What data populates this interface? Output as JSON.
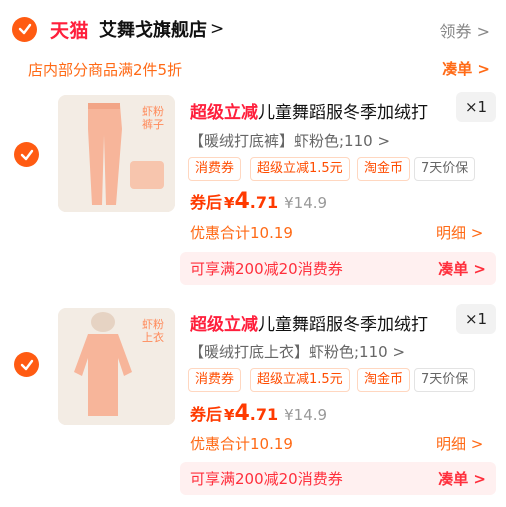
{
  "shop": {
    "platform": "天猫",
    "name": "艾舞戈旗舰店",
    "name_chevron": ">",
    "coupon_link": "领券 >",
    "promo_text": "店内部分商品满2件5折",
    "promo_link": "凑单 >"
  },
  "items": [
    {
      "badge": "超级立减",
      "title": "儿童舞蹈服冬季加绒打",
      "qty": "×1",
      "sku": "【暖绒打底裤】虾粉色;110 >",
      "tags": [
        "消费券",
        "超级立减1.5元",
        "淘金币",
        "7天价保"
      ],
      "price_prefix": "券后",
      "price_yen": "¥",
      "price_int": "4",
      "price_dec": ".71",
      "price_orig": "¥14.9",
      "total": "优惠合计10.19",
      "detail": "明细 >",
      "coupon_text": "可享满200减20消费券",
      "coupon_cta": "凑单 >",
      "image_label": "虾粉 裤子",
      "image_type": "pants"
    },
    {
      "badge": "超级立减",
      "title": "儿童舞蹈服冬季加绒打",
      "qty": "×1",
      "sku": "【暖绒打底上衣】虾粉色;110 >",
      "tags": [
        "消费券",
        "超级立减1.5元",
        "淘金币",
        "7天价保"
      ],
      "price_prefix": "券后",
      "price_yen": "¥",
      "price_int": "4",
      "price_dec": ".71",
      "price_orig": "¥14.9",
      "total": "优惠合计10.19",
      "detail": "明细 >",
      "coupon_text": "可享满200减20消费券",
      "coupon_cta": "凑单 >",
      "image_label": "虾粉 上衣",
      "image_type": "top"
    }
  ],
  "colors": {
    "accent": "#ff5b12",
    "tmall_red": "#ff1f3c",
    "price": "#ff3a00",
    "coupon_bg": "#fff0f0"
  }
}
